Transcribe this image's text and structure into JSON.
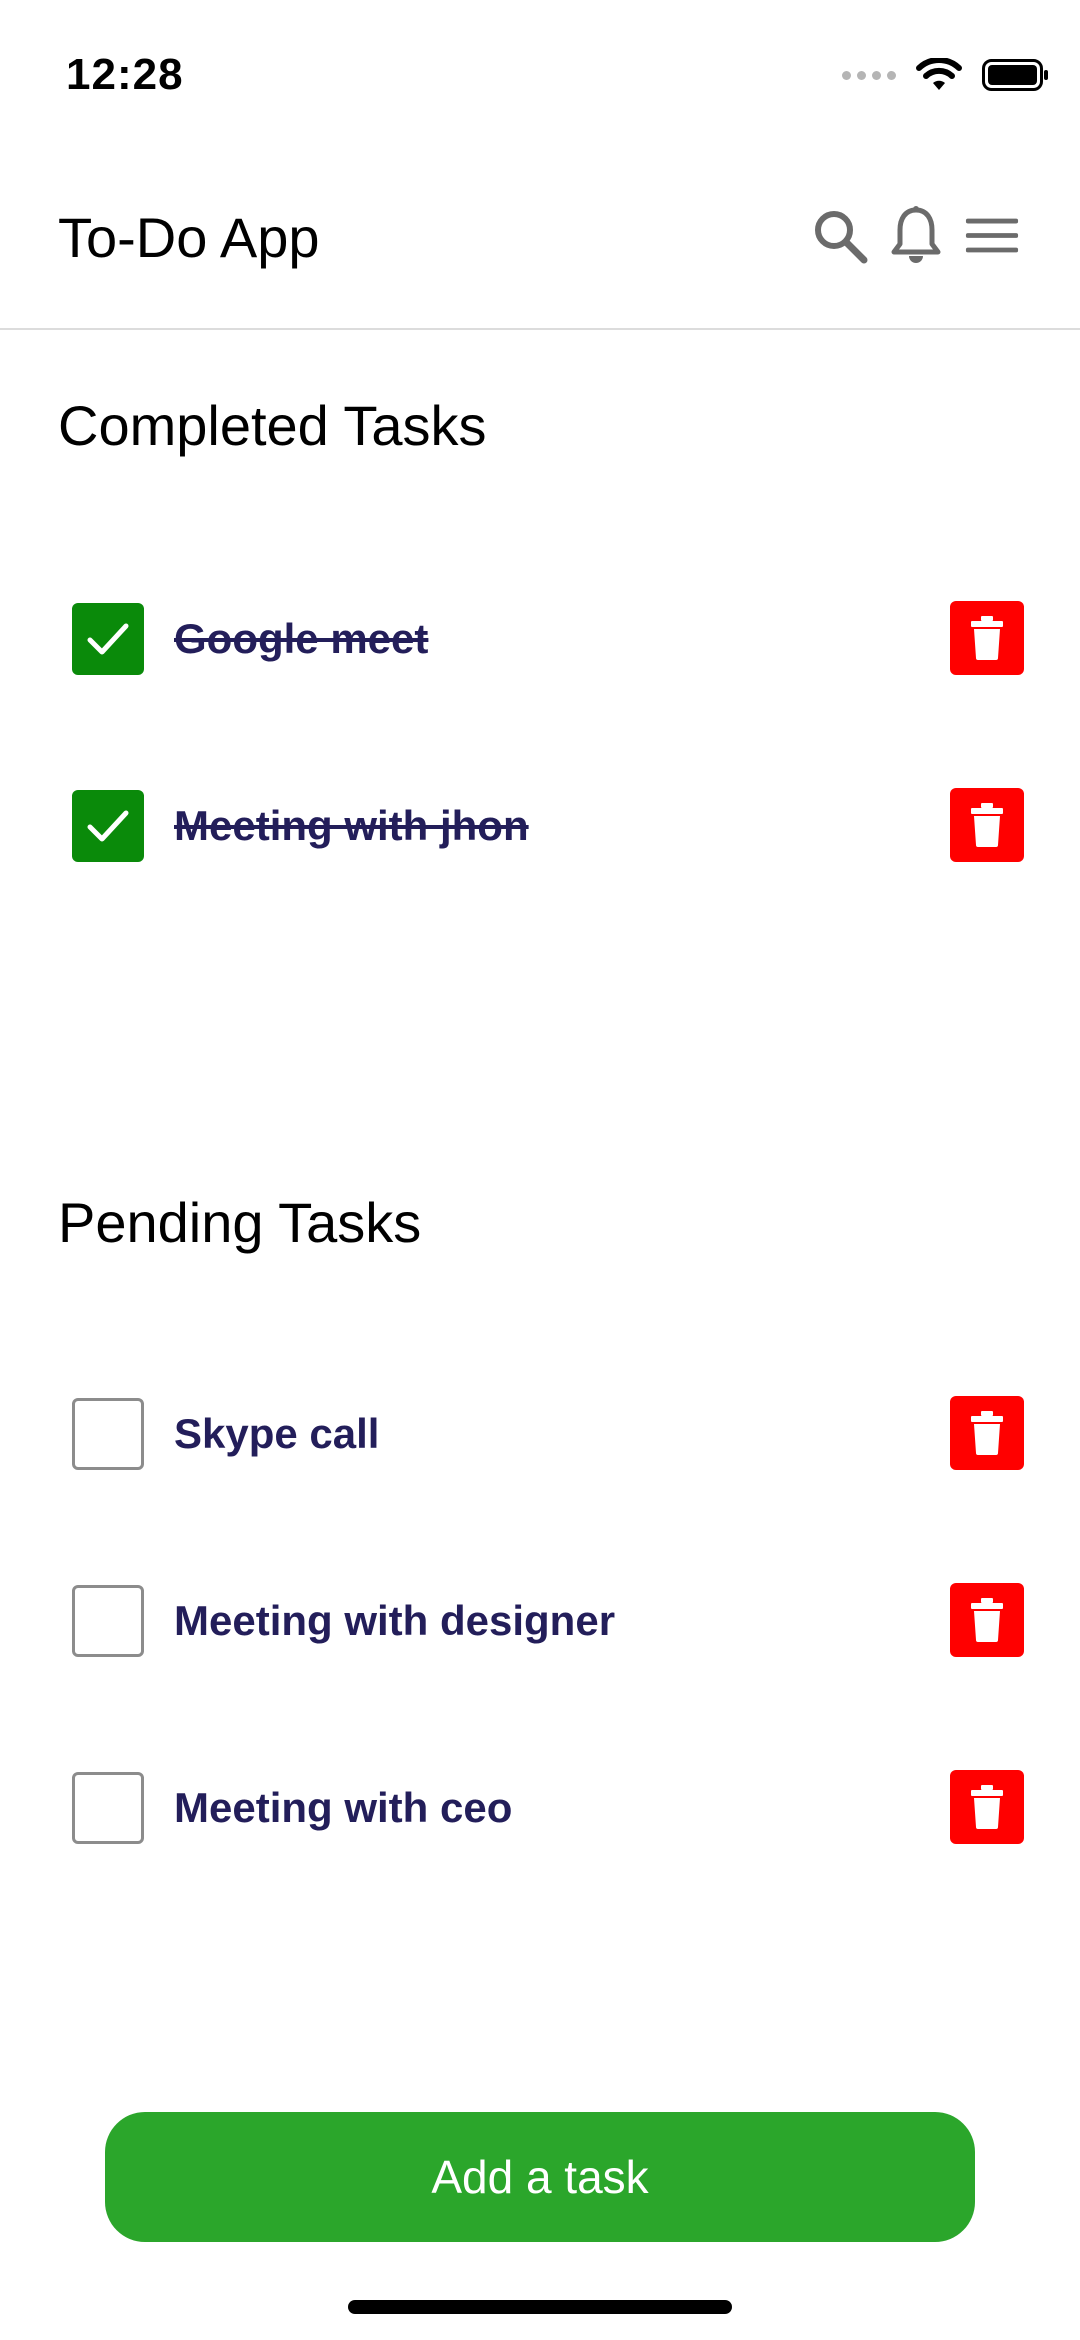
{
  "status_bar": {
    "time": "12:28"
  },
  "header": {
    "title": "To-Do App",
    "icons": [
      "search-icon",
      "bell-icon",
      "menu-icon"
    ]
  },
  "completed": {
    "title": "Completed Tasks",
    "tasks": [
      {
        "label": "Google meet",
        "checked": true
      },
      {
        "label": "Meeting with jhon",
        "checked": true
      }
    ]
  },
  "pending": {
    "title": "Pending Tasks",
    "tasks": [
      {
        "label": "Skype call",
        "checked": false
      },
      {
        "label": "Meeting with designer",
        "checked": false
      },
      {
        "label": "Meeting with ceo",
        "checked": false
      }
    ]
  },
  "actions": {
    "add_label": "Add a task"
  },
  "colors": {
    "checked_box": "#0a8a0a",
    "delete_button": "#ff0000",
    "add_button": "#2ba62b",
    "task_text": "#231e5a"
  }
}
